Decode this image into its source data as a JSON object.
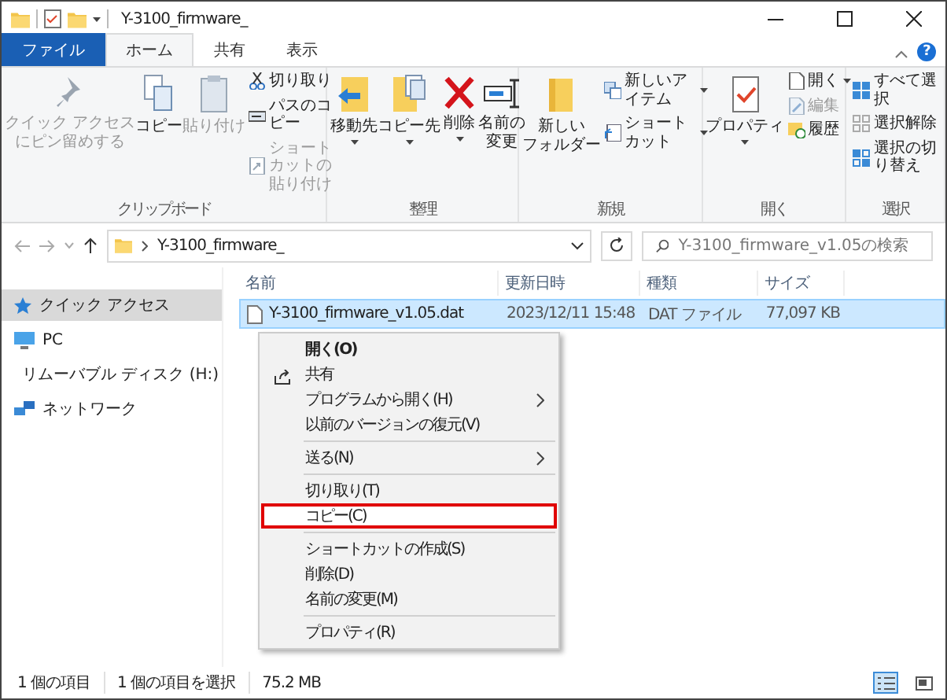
{
  "window": {
    "title": "Y-3100_firmware_"
  },
  "tabs": [
    {
      "label": "ファイル",
      "kind": "file",
      "selected": false
    },
    {
      "label": "ホーム",
      "kind": "tab",
      "selected": true
    },
    {
      "label": "共有",
      "kind": "tab",
      "selected": false
    },
    {
      "label": "表示",
      "kind": "tab",
      "selected": false
    }
  ],
  "help_label": "?",
  "ribbon": {
    "groups": [
      {
        "label": "クリップボード",
        "large": [
          {
            "lines": [
              "クイック アクセス",
              "にピン留めする"
            ],
            "disabled": true,
            "caret": false
          },
          {
            "lines": [
              "コピー"
            ],
            "disabled": false,
            "caret": false
          },
          {
            "lines": [
              "貼り付け"
            ],
            "disabled": true,
            "caret": false
          }
        ],
        "small": [
          {
            "label": "切り取り",
            "disabled": false,
            "caret": false
          },
          {
            "label": "パスのコピー",
            "disabled": false,
            "caret": false
          },
          {
            "label": "ショートカットの貼り付け",
            "disabled": true,
            "caret": false
          }
        ]
      },
      {
        "label": "整理",
        "large": [
          {
            "lines": [
              "移動先"
            ],
            "disabled": false,
            "caret": true
          },
          {
            "lines": [
              "コピー先"
            ],
            "disabled": false,
            "caret": true
          },
          {
            "lines": [
              "削除"
            ],
            "disabled": false,
            "caret": true
          },
          {
            "lines": [
              "名前の",
              "変更"
            ],
            "disabled": false,
            "caret": false
          }
        ]
      },
      {
        "label": "新規",
        "large": [
          {
            "lines": [
              "新しい",
              "フォルダー"
            ],
            "disabled": false,
            "caret": false
          }
        ],
        "small": [
          {
            "label": "新しいアイテム",
            "disabled": false,
            "caret": true
          },
          {
            "label": "ショートカット",
            "disabled": false,
            "caret": true
          }
        ]
      },
      {
        "label": "開く",
        "large": [
          {
            "lines": [
              "プロパティ"
            ],
            "disabled": false,
            "caret": true
          }
        ],
        "small": [
          {
            "label": "開く",
            "disabled": false,
            "caret": true
          },
          {
            "label": "編集",
            "disabled": true,
            "caret": false
          },
          {
            "label": "履歴",
            "disabled": false,
            "caret": false
          }
        ]
      },
      {
        "label": "選択",
        "small": [
          {
            "label": "すべて選択",
            "disabled": false,
            "caret": false
          },
          {
            "label": "選択解除",
            "disabled": false,
            "caret": false
          },
          {
            "label": "選択の切り替え",
            "disabled": false,
            "caret": false
          }
        ]
      }
    ]
  },
  "address": {
    "path": "Y-3100_firmware_",
    "search_placeholder": "Y-3100_firmware_v1.05の検索"
  },
  "sidebar": {
    "items": [
      {
        "label": "クイック アクセス",
        "selected": true
      },
      {
        "label": "PC",
        "selected": false
      },
      {
        "label": "リムーバブル ディスク (H:)",
        "selected": false
      },
      {
        "label": "ネットワーク",
        "selected": false
      }
    ]
  },
  "table": {
    "columns": [
      "名前",
      "更新日時",
      "種類",
      "サイズ"
    ],
    "rows": [
      {
        "name": "Y-3100_firmware_v1.05.dat",
        "modified": "2023/12/11 15:48",
        "type": "DAT ファイル",
        "size": "77,097 KB",
        "selected": true
      }
    ]
  },
  "context_menu": {
    "items": [
      {
        "kind": "default",
        "label": "開く(O)",
        "highlighted": false
      },
      {
        "kind": "share",
        "label": "共有",
        "highlighted": false
      },
      {
        "kind": "submenu",
        "label": "プログラムから開く(H)",
        "highlighted": false
      },
      {
        "kind": "item",
        "label": "以前のバージョンの復元(V)",
        "highlighted": false
      },
      {
        "kind": "separator"
      },
      {
        "kind": "submenu",
        "label": "送る(N)",
        "highlighted": false
      },
      {
        "kind": "separator"
      },
      {
        "kind": "item",
        "label": "切り取り(T)",
        "highlighted": false
      },
      {
        "kind": "item",
        "label": "コピー(C)",
        "highlighted": true
      },
      {
        "kind": "separator"
      },
      {
        "kind": "item",
        "label": "ショートカットの作成(S)",
        "highlighted": false
      },
      {
        "kind": "item",
        "label": "削除(D)",
        "highlighted": false
      },
      {
        "kind": "item",
        "label": "名前の変更(M)",
        "highlighted": false
      },
      {
        "kind": "separator"
      },
      {
        "kind": "item",
        "label": "プロパティ(R)",
        "highlighted": false
      }
    ]
  },
  "status_bar": {
    "items": [
      "1 個の項目",
      "1 個の項目を選択",
      "75.2 MB"
    ],
    "views": [
      {
        "kind": "details",
        "selected": true
      },
      {
        "kind": "large_icons",
        "selected": false
      }
    ]
  }
}
